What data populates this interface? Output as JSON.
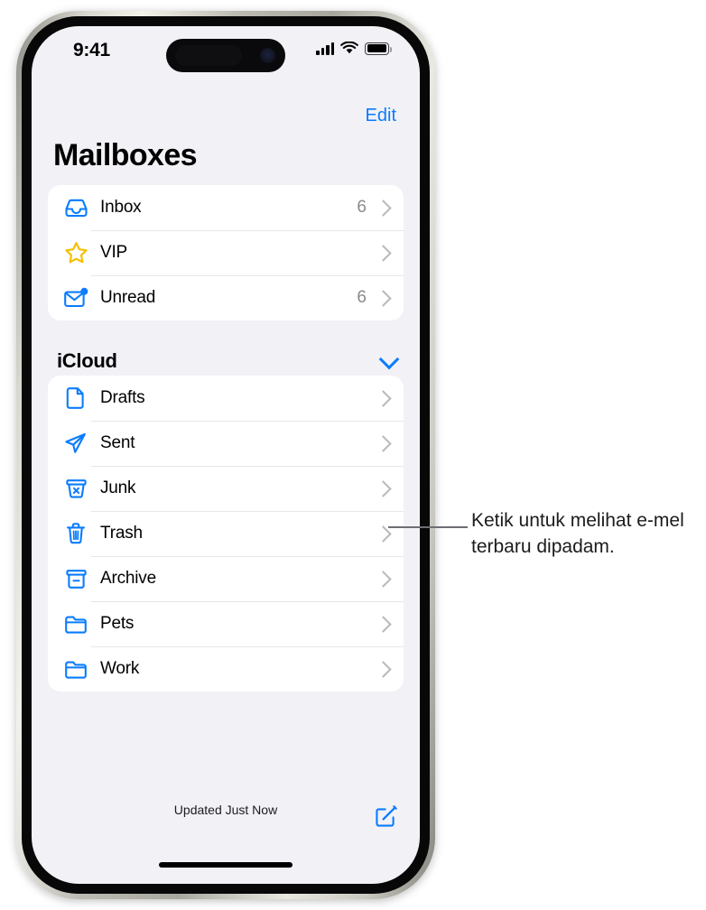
{
  "status_bar": {
    "time": "9:41",
    "cellular_icon": "signal-bars-icon",
    "wifi_icon": "wifi-icon",
    "battery_icon": "battery-icon"
  },
  "nav": {
    "edit_label": "Edit"
  },
  "page": {
    "title": "Mailboxes"
  },
  "primary_mailboxes": [
    {
      "icon": "inbox-tray-icon",
      "label": "Inbox",
      "count": "6"
    },
    {
      "icon": "star-icon",
      "label": "VIP",
      "count": ""
    },
    {
      "icon": "unread-envelope-icon",
      "label": "Unread",
      "count": "6"
    }
  ],
  "icloud_section": {
    "title": "iCloud",
    "collapse_icon": "chevron-down-icon",
    "mailboxes": [
      {
        "icon": "document-icon",
        "label": "Drafts",
        "count": ""
      },
      {
        "icon": "paper-plane-icon",
        "label": "Sent",
        "count": ""
      },
      {
        "icon": "junk-bin-icon",
        "label": "Junk",
        "count": ""
      },
      {
        "icon": "trash-icon",
        "label": "Trash",
        "count": ""
      },
      {
        "icon": "archive-box-icon",
        "label": "Archive",
        "count": ""
      },
      {
        "icon": "folder-icon",
        "label": "Pets",
        "count": ""
      },
      {
        "icon": "folder-icon",
        "label": "Work",
        "count": ""
      }
    ]
  },
  "toolbar": {
    "status_text": "Updated Just Now",
    "compose_icon": "compose-icon"
  },
  "callout": {
    "text": "Ketik untuk melihat e-mel terbaru dipadam."
  },
  "colors": {
    "accent_blue": "#0a7cff",
    "star_yellow": "#f5bf00",
    "page_background": "#f2f1f6",
    "card_background": "#ffffff",
    "secondary_text": "#8a8a8e"
  }
}
